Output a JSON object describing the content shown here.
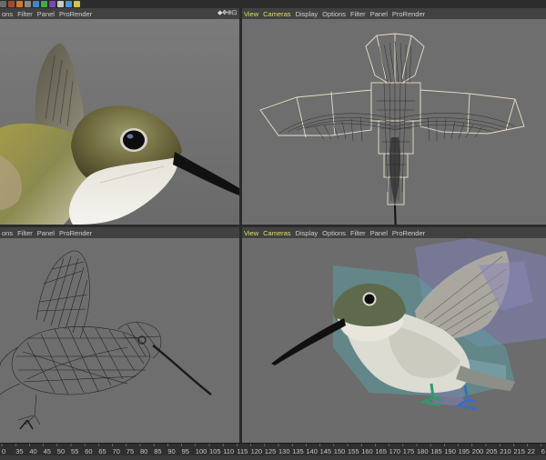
{
  "toolbar": {
    "icons": [
      "render-icon",
      "render-settings-icon",
      "cube-icon",
      "pen-icon",
      "nurbs-icon",
      "array-icon",
      "deformer-icon",
      "scene-icon",
      "camera-icon",
      "light-icon"
    ]
  },
  "viewports": {
    "top_left": {
      "menu": [
        "ons",
        "Filter",
        "Panel",
        "ProRender"
      ],
      "nav_icons": "◆✥⊕⊡"
    },
    "top_right": {
      "menu": [
        "View",
        "Cameras",
        "Display",
        "Options",
        "Filter",
        "Panel",
        "ProRender"
      ]
    },
    "bottom_left": {
      "menu": [
        "ons",
        "Filter",
        "Panel",
        "ProRender"
      ]
    },
    "bottom_right": {
      "menu": [
        "View",
        "Cameras",
        "Display",
        "Options",
        "Filter",
        "Panel",
        "ProRender"
      ]
    }
  },
  "timeline": {
    "ticks": [
      "0",
      "35",
      "40",
      "45",
      "50",
      "55",
      "60",
      "65",
      "70",
      "75",
      "80",
      "85",
      "90",
      "95",
      "100",
      "105",
      "110",
      "115",
      "120",
      "125",
      "130",
      "135",
      "140",
      "145",
      "150",
      "155",
      "160",
      "165",
      "170",
      "175",
      "180",
      "185",
      "190",
      "195",
      "200",
      "205",
      "210",
      "215",
      "22",
      "6 F"
    ]
  },
  "colors": {
    "menu_highlight": "#dede6a",
    "viewport_bg": "#6f6f6f",
    "ui_dark": "#414141"
  }
}
